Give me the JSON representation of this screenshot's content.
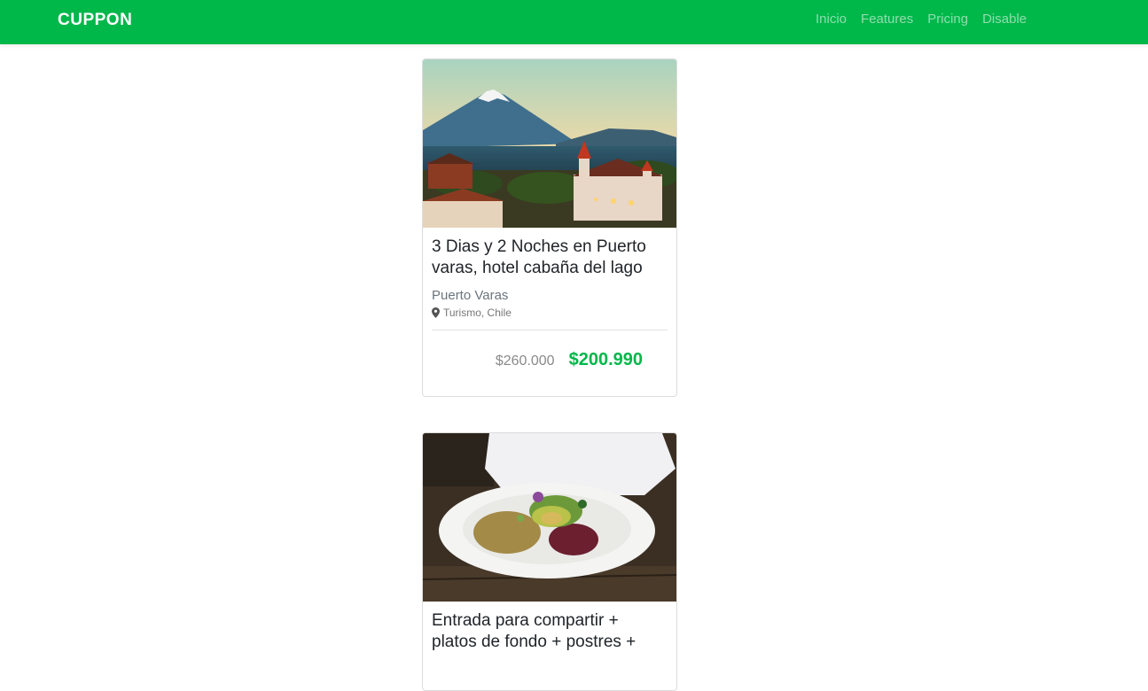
{
  "navbar": {
    "brand": "CUPPON",
    "links": [
      "Inicio",
      "Features",
      "Pricing",
      "Disable"
    ]
  },
  "deals": [
    {
      "image": "lake-town-volcano-photo",
      "title": "3 Dias y 2 Noches en Puerto varas, hotel cabaña del lago",
      "location_name": "Puerto Varas",
      "category": "Turismo, Chile",
      "old_price": "$260.000",
      "new_price": "$200.990"
    },
    {
      "image": "salad-plate-photo",
      "title": "Entrada para compartir + platos de fondo + postres +"
    }
  ],
  "colors": {
    "brand": "#00b74a"
  }
}
